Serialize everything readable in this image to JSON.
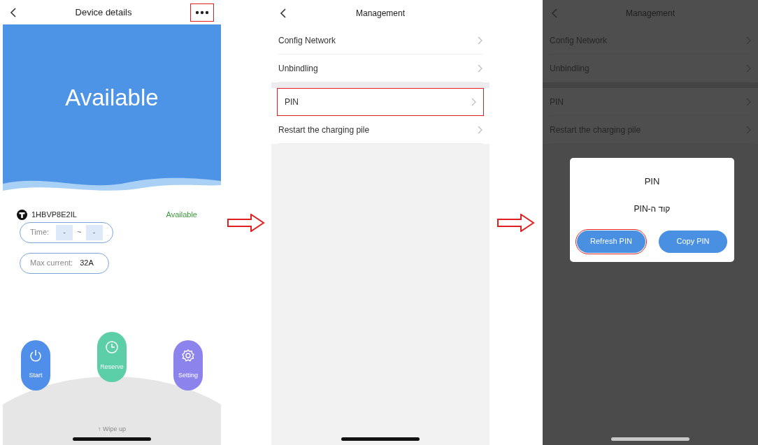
{
  "device_details": {
    "title": "Device details",
    "more_highlighted": true,
    "status_banner": "Available",
    "device_id": "1HBVP8E2IL",
    "device_status": "Available",
    "time_label": "Time:",
    "time_start": "-",
    "time_separator": "~",
    "time_end": "-",
    "max_current_label": "Max current:",
    "max_current_value": "32A",
    "actions": [
      {
        "label": "Start",
        "kind": "power",
        "color": "#4f8fea"
      },
      {
        "label": "Reserve",
        "kind": "clock",
        "color": "#5ccfa8"
      },
      {
        "label": "Setting",
        "kind": "gear",
        "color": "#8c84ec"
      }
    ],
    "swipe_hint": "↑ Wipe up"
  },
  "management": {
    "title": "Management",
    "items": [
      {
        "label": "Config Network",
        "group_start": false,
        "highlighted": false
      },
      {
        "label": "Unbindling",
        "group_start": false,
        "highlighted": false
      },
      {
        "label": "PIN",
        "group_start": true,
        "highlighted": true
      },
      {
        "label": "Restart the charging pile",
        "group_start": false,
        "highlighted": false
      }
    ]
  },
  "pin_dialog": {
    "background_title": "Management",
    "background_items": [
      {
        "label": "Config Network",
        "group_start": false
      },
      {
        "label": "Unbindling",
        "group_start": false
      },
      {
        "label": "PIN",
        "group_start": true
      },
      {
        "label": "Restart the charging pile",
        "group_start": false
      }
    ],
    "title": "PIN",
    "message": "קוד ה-PIN",
    "buttons": [
      {
        "label": "Refresh PIN",
        "highlighted": true
      },
      {
        "label": "Copy PIN",
        "highlighted": false
      }
    ]
  }
}
